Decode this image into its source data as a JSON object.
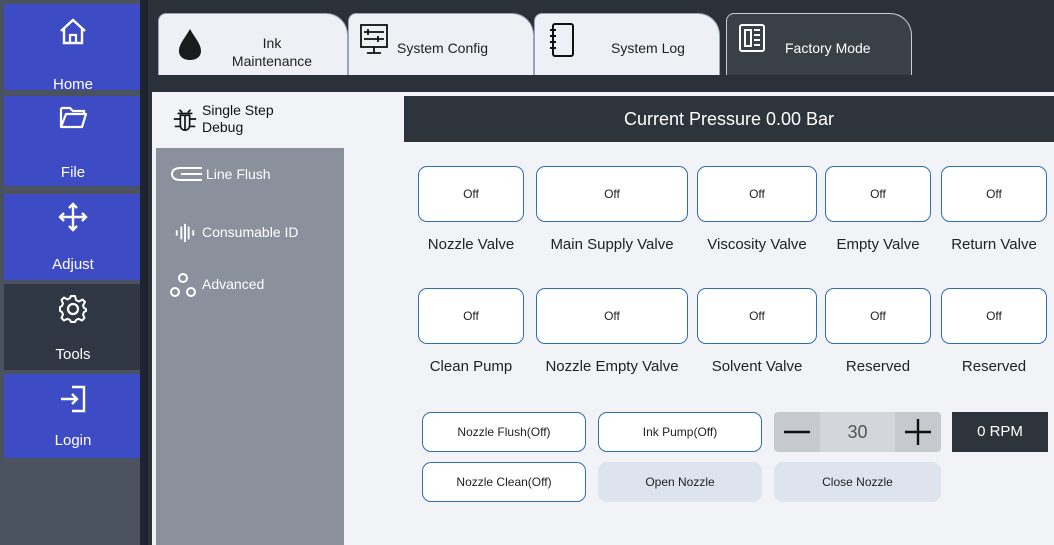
{
  "nav": {
    "items": [
      {
        "label": "Home",
        "icon": "home-icon"
      },
      {
        "label": "File",
        "icon": "folder-icon"
      },
      {
        "label": "Adjust",
        "icon": "move-arrows-icon"
      },
      {
        "label": "Tools",
        "icon": "gear-icon"
      },
      {
        "label": "Login",
        "icon": "login-icon"
      }
    ]
  },
  "tabs": [
    {
      "label_line1": "Ink",
      "label_line2": "Maintenance",
      "icon": "ink-drop-icon"
    },
    {
      "label": "System Config",
      "icon": "sliders-icon"
    },
    {
      "label": "System Log",
      "icon": "notebook-icon"
    },
    {
      "label": "Factory Mode",
      "icon": "factory-doc-icon"
    }
  ],
  "subnav": [
    {
      "label_line1": "Single Step",
      "label_line2": "Debug",
      "icon": "bug-icon"
    },
    {
      "label": "Line Flush",
      "icon": "pipe-icon"
    },
    {
      "label": "Consumable ID",
      "icon": "signal-bars-icon"
    },
    {
      "label": "Advanced",
      "icon": "nodes-icon"
    }
  ],
  "pressure": "Current Pressure 0.00 Bar",
  "valves_row1": [
    {
      "state": "Off",
      "label": "Nozzle Valve"
    },
    {
      "state": "Off",
      "label": "Main Supply Valve"
    },
    {
      "state": "Off",
      "label": "Viscosity Valve"
    },
    {
      "state": "Off",
      "label": "Empty Valve"
    },
    {
      "state": "Off",
      "label": "Return Valve"
    }
  ],
  "valves_row2": [
    {
      "state": "Off",
      "label": "Clean Pump"
    },
    {
      "state": "Off",
      "label": "Nozzle Empty Valve"
    },
    {
      "state": "Off",
      "label": "Solvent Valve"
    },
    {
      "state": "Off",
      "label": "Reserved"
    },
    {
      "state": "Off",
      "label": "Reserved"
    }
  ],
  "actions": {
    "nozzle_flush": "Nozzle Flush(Off)",
    "ink_pump": "Ink Pump(Off)",
    "nozzle_clean": "Nozzle Clean(Off)",
    "open_nozzle": "Open Nozzle",
    "close_nozzle": "Close Nozzle"
  },
  "pump_speed": {
    "value": "30",
    "minus": "—",
    "plus": "+"
  },
  "rpm": "0 RPM",
  "colors": {
    "nav_blue": "#3d4bc4",
    "nav_active": "#2f3744",
    "button_border": "#2f6fb0",
    "header_dark": "#2e343c",
    "subnav_gray": "#8a919c"
  }
}
